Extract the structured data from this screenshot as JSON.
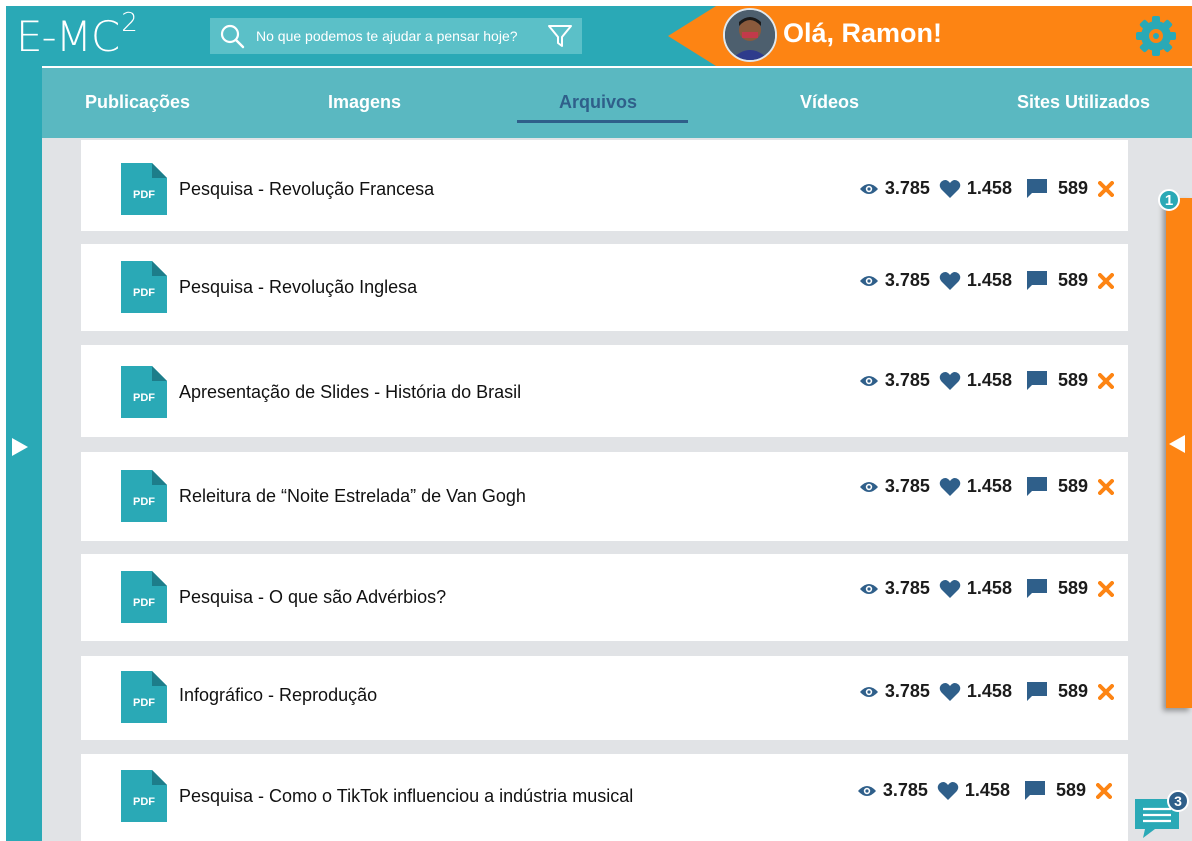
{
  "header": {
    "logo_text": "E-MC",
    "logo_superscript": "2",
    "search_placeholder": "No que podemos te ajudar a pensar hoje?",
    "greeting": "Olá, Ramon!",
    "icons": {
      "search": "search-icon",
      "filter": "filter-icon",
      "settings": "gear-icon"
    }
  },
  "tabs": [
    {
      "label": "Publicações",
      "active": false
    },
    {
      "label": "Imagens",
      "active": false
    },
    {
      "label": "Arquivos",
      "active": true
    },
    {
      "label": "Vídeos",
      "active": false
    },
    {
      "label": "Sites Utilizados",
      "active": false
    }
  ],
  "files": [
    {
      "type": "PDF",
      "title": "Pesquisa - Revolução Francesa",
      "views": "3.785",
      "likes": "1.458",
      "comments": "589"
    },
    {
      "type": "PDF",
      "title": "Pesquisa - Revolução Inglesa",
      "views": "3.785",
      "likes": "1.458",
      "comments": "589"
    },
    {
      "type": "PDF",
      "title": "Apresentação de Slides - História do Brasil",
      "views": "3.785",
      "likes": "1.458",
      "comments": "589"
    },
    {
      "type": "PDF",
      "title": "Releitura de “Noite Estrelada” de Van Gogh",
      "views": "3.785",
      "likes": "1.458",
      "comments": "589"
    },
    {
      "type": "PDF",
      "title": "Pesquisa - O que são Advérbios?",
      "views": "3.785",
      "likes": "1.458",
      "comments": "589"
    },
    {
      "type": "PDF",
      "title": "Infográfico - Reprodução",
      "views": "3.785",
      "likes": "1.458",
      "comments": "589"
    },
    {
      "type": "PDF",
      "title": "Pesquisa - Como o TikTok influenciou a indústria musical",
      "views": "3.785",
      "likes": "1.458",
      "comments": "589"
    }
  ],
  "right_panel_badge": "1",
  "chat_badge": "3",
  "colors": {
    "teal": "#2aa9b6",
    "tab_bar": "#5ab8c1",
    "accent_orange": "#fd8413",
    "navy": "#2f5f8a",
    "background": "#e1e3e6"
  }
}
